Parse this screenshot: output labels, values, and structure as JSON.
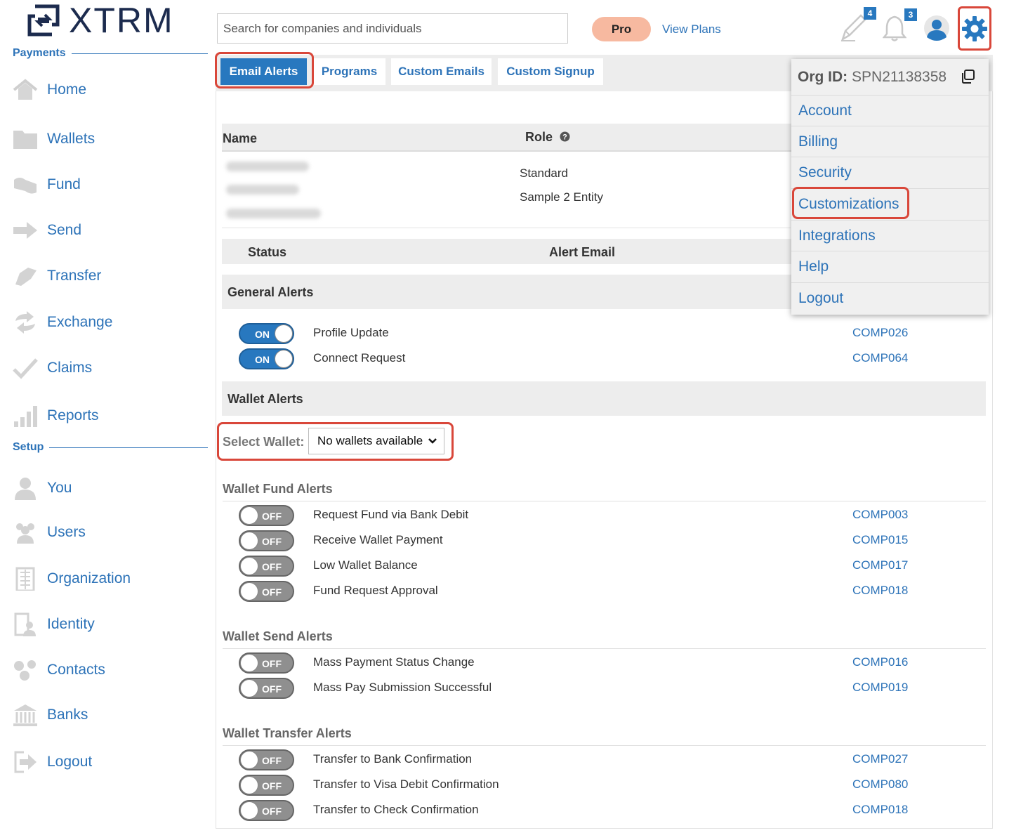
{
  "brand": {
    "name": "XTRM"
  },
  "sidebar": {
    "payments_header": "Payments",
    "setup_header": "Setup",
    "payments_items": [
      {
        "label": "Home",
        "icon": "home-icon"
      },
      {
        "label": "Wallets",
        "icon": "folder-icon"
      },
      {
        "label": "Fund",
        "icon": "fund-icon"
      },
      {
        "label": "Send",
        "icon": "send-arrow-icon"
      },
      {
        "label": "Transfer",
        "icon": "transfer-icon"
      },
      {
        "label": "Exchange",
        "icon": "exchange-icon"
      },
      {
        "label": "Claims",
        "icon": "checkmark-icon"
      },
      {
        "label": "Reports",
        "icon": "bar-chart-icon"
      }
    ],
    "setup_items": [
      {
        "label": "You",
        "icon": "person-icon"
      },
      {
        "label": "Users",
        "icon": "users-icon"
      },
      {
        "label": "Organization",
        "icon": "building-icon"
      },
      {
        "label": "Identity",
        "icon": "identity-icon"
      },
      {
        "label": "Contacts",
        "icon": "contacts-icon"
      },
      {
        "label": "Banks",
        "icon": "bank-icon"
      },
      {
        "label": "Logout",
        "icon": "logout-icon"
      }
    ]
  },
  "topbar": {
    "search_placeholder": "Search for companies and individuals",
    "plan_badge": "Pro",
    "view_plans": "View Plans",
    "tasks_count": "4",
    "notifications_count": "3"
  },
  "tabs": [
    "Email Alerts",
    "Programs",
    "Custom Emails",
    "Custom Signup"
  ],
  "user_table": {
    "col_name": "Name",
    "col_role": "Role",
    "role_lines": [
      "Standard",
      "Sample 2 Entity"
    ]
  },
  "alerts_table": {
    "col_status": "Status",
    "col_alert_email": "Alert Email"
  },
  "general_alerts": {
    "title": "General Alerts",
    "rows": [
      {
        "status": "ON",
        "label": "Profile Update",
        "code": "COMP026"
      },
      {
        "status": "ON",
        "label": "Connect Request",
        "code": "COMP064"
      }
    ]
  },
  "wallet_alerts": {
    "title": "Wallet Alerts",
    "select_label": "Select Wallet:",
    "select_value": "No wallets available"
  },
  "wallet_fund_alerts": {
    "title": "Wallet Fund Alerts",
    "rows": [
      {
        "status": "OFF",
        "label": "Request Fund via Bank Debit",
        "code": "COMP003"
      },
      {
        "status": "OFF",
        "label": "Receive Wallet Payment",
        "code": "COMP015"
      },
      {
        "status": "OFF",
        "label": "Low Wallet Balance",
        "code": "COMP017"
      },
      {
        "status": "OFF",
        "label": "Fund Request Approval",
        "code": "COMP018"
      }
    ]
  },
  "wallet_send_alerts": {
    "title": "Wallet Send Alerts",
    "rows": [
      {
        "status": "OFF",
        "label": "Mass Payment Status Change",
        "code": "COMP016"
      },
      {
        "status": "OFF",
        "label": "Mass Pay Submission Successful",
        "code": "COMP019"
      }
    ]
  },
  "wallet_transfer_alerts": {
    "title": "Wallet Transfer Alerts",
    "rows": [
      {
        "status": "OFF",
        "label": "Transfer to Bank Confirmation",
        "code": "COMP027"
      },
      {
        "status": "OFF",
        "label": "Transfer to Visa Debit Confirmation",
        "code": "COMP080"
      },
      {
        "status": "OFF",
        "label": "Transfer to Check Confirmation",
        "code": "COMP018"
      }
    ]
  },
  "settings_menu": {
    "org_label": "Org ID:",
    "org_id": "SPN21138358",
    "items": [
      "Account",
      "Billing",
      "Security",
      "Customizations",
      "Integrations",
      "Help",
      "Logout"
    ]
  },
  "colors": {
    "accent": "#2878bf",
    "link": "#2d73b8",
    "highlight": "#d9473a",
    "pro_badge": "#f7b9a0",
    "panel_gray": "#ededed"
  }
}
